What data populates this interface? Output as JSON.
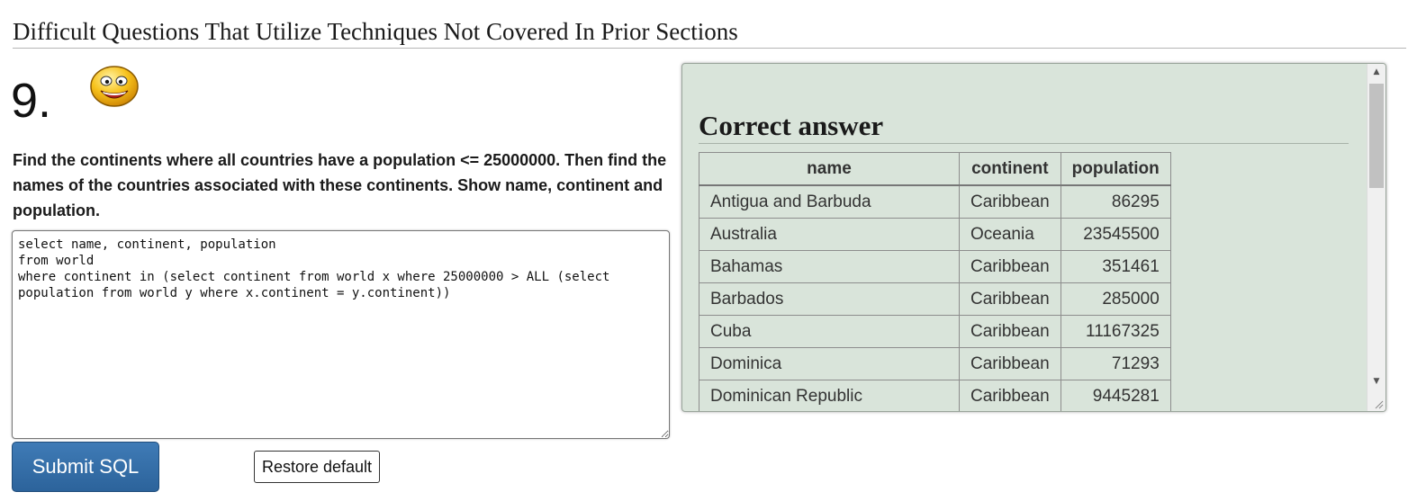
{
  "section": {
    "title": "Difficult Questions That Utilize Techniques Not Covered In Prior Sections"
  },
  "question": {
    "number": "9.",
    "text": "Find the continents where all countries have a population <= 25000000. Then find the names of the countries associated with these continents. Show name, continent and population.",
    "icon": "smiley-face-icon"
  },
  "editor": {
    "value": "select name, continent, population\nfrom world\nwhere continent in (select continent from world x where 25000000 > ALL (select population from world y where x.continent = y.continent))"
  },
  "buttons": {
    "submit_label": "Submit SQL",
    "restore_label": "Restore default"
  },
  "answer": {
    "title": "Correct answer",
    "columns": [
      "name",
      "continent",
      "population"
    ],
    "rows": [
      [
        "Antigua and Barbuda",
        "Caribbean",
        "86295"
      ],
      [
        "Australia",
        "Oceania",
        "23545500"
      ],
      [
        "Bahamas",
        "Caribbean",
        "351461"
      ],
      [
        "Barbados",
        "Caribbean",
        "285000"
      ],
      [
        "Cuba",
        "Caribbean",
        "11167325"
      ],
      [
        "Dominica",
        "Caribbean",
        "71293"
      ],
      [
        "Dominican Republic",
        "Caribbean",
        "9445281"
      ]
    ]
  },
  "colors": {
    "panel_bg": "#d9e4da",
    "submit_bg": "#336ea7",
    "smiley_yellow": "#f7c21c"
  }
}
